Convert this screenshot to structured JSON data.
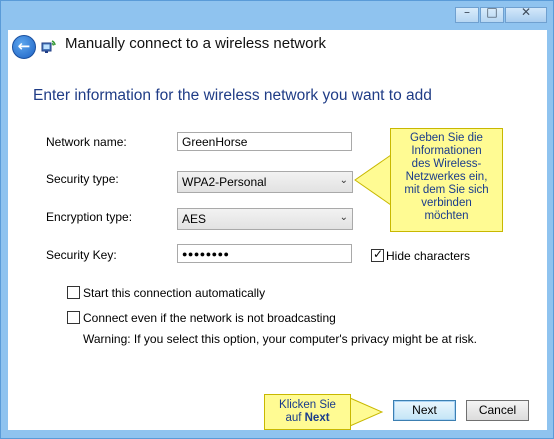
{
  "window": {
    "title": "Manually connect to a wireless network",
    "caption_buttons": {
      "minimize": "–",
      "maximize": "□",
      "close": "✕"
    }
  },
  "heading": "Enter information for the wireless network you want to add",
  "form": {
    "network_name": {
      "label": "Network name:",
      "value": "GreenHorse"
    },
    "security_type": {
      "label": "Security type:",
      "value": "WPA2-Personal"
    },
    "encryption_type": {
      "label": "Encryption type:",
      "value": "AES"
    },
    "security_key": {
      "label": "Security Key:",
      "value": "●●●●●●●●"
    },
    "hide_characters": {
      "label": "Hide characters",
      "checked": true
    }
  },
  "options": {
    "start_auto": {
      "label": "Start this connection automatically",
      "checked": false
    },
    "connect_not_broadcasting": {
      "label": "Connect even if the network is not broadcasting",
      "checked": false
    },
    "warning": "Warning: If you select this option, your computer's privacy might be at risk."
  },
  "buttons": {
    "next": "Next",
    "cancel": "Cancel"
  },
  "callouts": {
    "info_lines": [
      "Geben Sie die",
      "Informationen",
      "des Wireless-",
      "Netzwerkes ein,",
      "mit dem Sie sich",
      "verbinden",
      "möchten"
    ],
    "next_line1": "Klicken Sie",
    "next_line2_prefix": "auf ",
    "next_line2_bold": "Next"
  },
  "colors": {
    "heading": "#1f3c86",
    "frame": "#8fc3ef",
    "callout_bg": "#fffb93",
    "callout_text": "#1a3c8c"
  },
  "icons": {
    "back": "back-arrow-icon",
    "network": "wireless-network-icon"
  }
}
